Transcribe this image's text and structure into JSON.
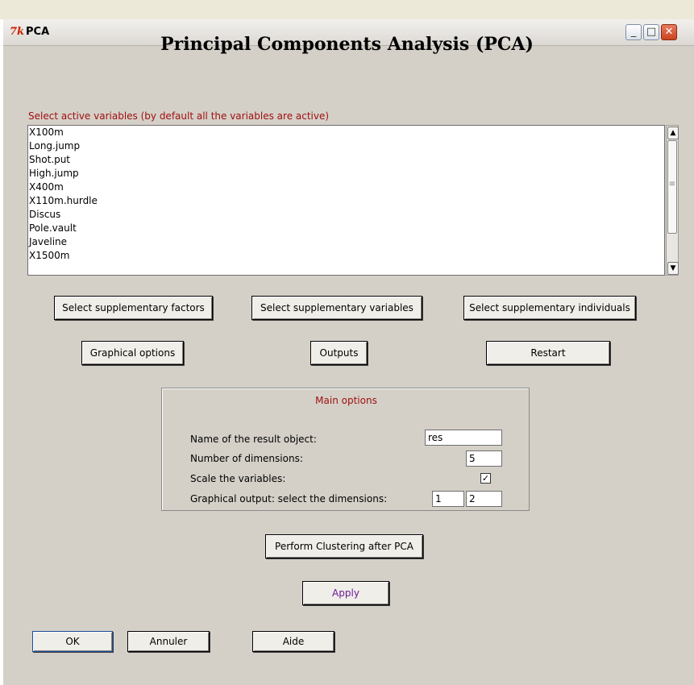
{
  "window": {
    "title": "PCA",
    "icon": "tk-feather-icon"
  },
  "heading": "Principal Components Analysis (PCA)",
  "variables": {
    "label": "Select active variables (by default all the variables are active)",
    "items": [
      "X100m",
      "Long.jump",
      "Shot.put",
      "High.jump",
      "X400m",
      "X110m.hurdle",
      "Discus",
      "Pole.vault",
      "Javeline",
      "X1500m"
    ]
  },
  "buttons": {
    "supp_factors": "Select supplementary factors",
    "supp_variables": "Select supplementary variables",
    "supp_individuals": "Select supplementary individuals",
    "graphical_options": "Graphical options",
    "outputs": "Outputs",
    "restart": "Restart",
    "clustering": "Perform Clustering after PCA",
    "apply": "Apply",
    "ok": "OK",
    "cancel": "Annuler",
    "help": "Aide"
  },
  "main_options": {
    "title": "Main options",
    "result_name_label": "Name of the result object:",
    "result_name_value": "res",
    "ndim_label": "Number of dimensions:",
    "ndim_value": "5",
    "scale_label": "Scale the variables:",
    "scale_checked": true,
    "graph_dims_label": "Graphical output: select the dimensions:",
    "graph_dim1": "1",
    "graph_dim2": "2"
  },
  "colors": {
    "accent_label": "#a01010",
    "apply_text": "#6a1a9a",
    "ok_border": "#1d4a9a"
  }
}
